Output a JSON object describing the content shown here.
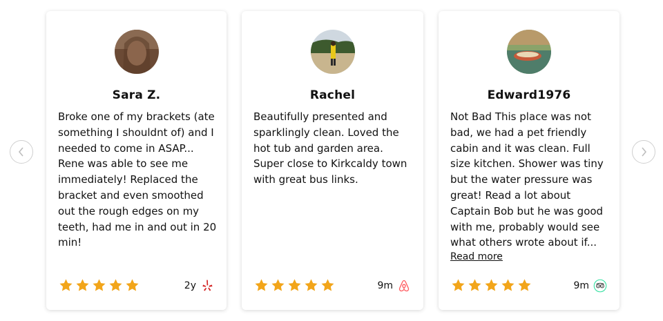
{
  "carousel": {
    "prev_icon": "chevron-left-icon",
    "next_icon": "chevron-right-icon"
  },
  "reviews": [
    {
      "name": "Sara Z.",
      "text": "Broke one of my brackets (ate something I shouldnt of) and I needed to come in ASAP... Rene was able to see me immediately! Replaced the bracket and even smoothed out the rough edges on my teeth, had me in and out in 20 min!",
      "rating": 5,
      "age": "2y",
      "source_icon": "yelp-icon"
    },
    {
      "name": "Rachel",
      "text": "Beautifully presented and sparklingly clean. Loved the hot tub and garden area. Super close to Kirkcaldy town with great bus links.",
      "rating": 5,
      "age": "9m",
      "source_icon": "airbnb-icon"
    },
    {
      "name": "Edward1976",
      "text": "Not Bad This place was not bad, we had a pet friendly cabin and it was clean. Full size kitchen. Shower was tiny but the water pressure was great! Read a lot about Captain Bob but he was good with me, probably would see what others wrote about if...",
      "read_more": "Read more",
      "rating": 5,
      "age": "9m",
      "source_icon": "tripadvisor-icon"
    }
  ],
  "colors": {
    "star": "#f2a51a",
    "yelp": "#d32323",
    "airbnb": "#ff5a5f",
    "tripadvisor": "#34e0a1"
  }
}
